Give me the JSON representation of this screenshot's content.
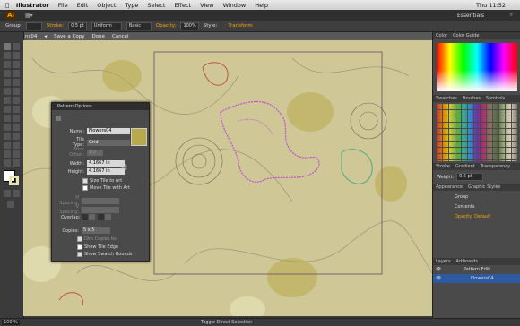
{
  "menu": {
    "items": [
      "Illustrator",
      "File",
      "Edit",
      "Object",
      "Type",
      "Select",
      "Effect",
      "View",
      "Window",
      "Help"
    ],
    "right": [
      "Essentials",
      "Thu 11:52"
    ]
  },
  "app": {
    "logo": "Ai"
  },
  "control": {
    "group": "Group",
    "stroke_label": "Stroke:",
    "stroke_value": "0.5 pt",
    "uniform": "Uniform",
    "basic": "Basic",
    "opacity_label": "Opacity:",
    "opacity_value": "100%",
    "style_label": "Style:",
    "transform": "Transform"
  },
  "isolation": {
    "tab": "ns04",
    "save_copy": "Save a Copy",
    "done": "Done",
    "cancel": "Cancel"
  },
  "pattern_options": {
    "title": "Pattern Options",
    "name_label": "Name:",
    "name_value": "Flowers04",
    "tile_type_label": "Tile Type:",
    "tile_type_value": "Grid",
    "brick_offset_label": "Brick Offset:",
    "brick_offset_value": "1/2",
    "width_label": "Width:",
    "width_value": "4.1667 in",
    "height_label": "Height:",
    "height_value": "4.1667 in",
    "size_tile": "Size Tile to Art",
    "move_tile": "Move Tile with Art",
    "hspacing_label": "H Spacing:",
    "vspacing_label": "V Spacing:",
    "overlap_label": "Overlap:",
    "copies_label": "Copies:",
    "copies_value": "5 x 5",
    "dim_copies": "Dim Copies to:",
    "show_tile_edge": "Show Tile Edge",
    "show_swatch_bounds": "Show Swatch Bounds"
  },
  "panels": {
    "color_tabs": [
      "Color",
      "Color Guide"
    ],
    "swatch_tabs": [
      "Swatches",
      "Brushes",
      "Symbols"
    ],
    "stroke_tabs": [
      "Stroke",
      "Gradient",
      "Transparency"
    ],
    "weight_label": "Weight:",
    "weight_value": "0.5 pt",
    "appearance_tabs": [
      "Appearance",
      "Graphic Styles"
    ],
    "appearance_items": [
      "Group",
      "Contents",
      "Opacity: Default"
    ],
    "layers_tabs": [
      "Layers",
      "Artboards"
    ],
    "layer_items": [
      "Pattern Edit...",
      "Flowers04"
    ]
  },
  "status": {
    "zoom": "100 %",
    "tool": "Toggle Direct Selection"
  },
  "colors": {
    "canvas": "#cfc896",
    "accent": "#f4a50c",
    "selection": "#c050d0"
  }
}
